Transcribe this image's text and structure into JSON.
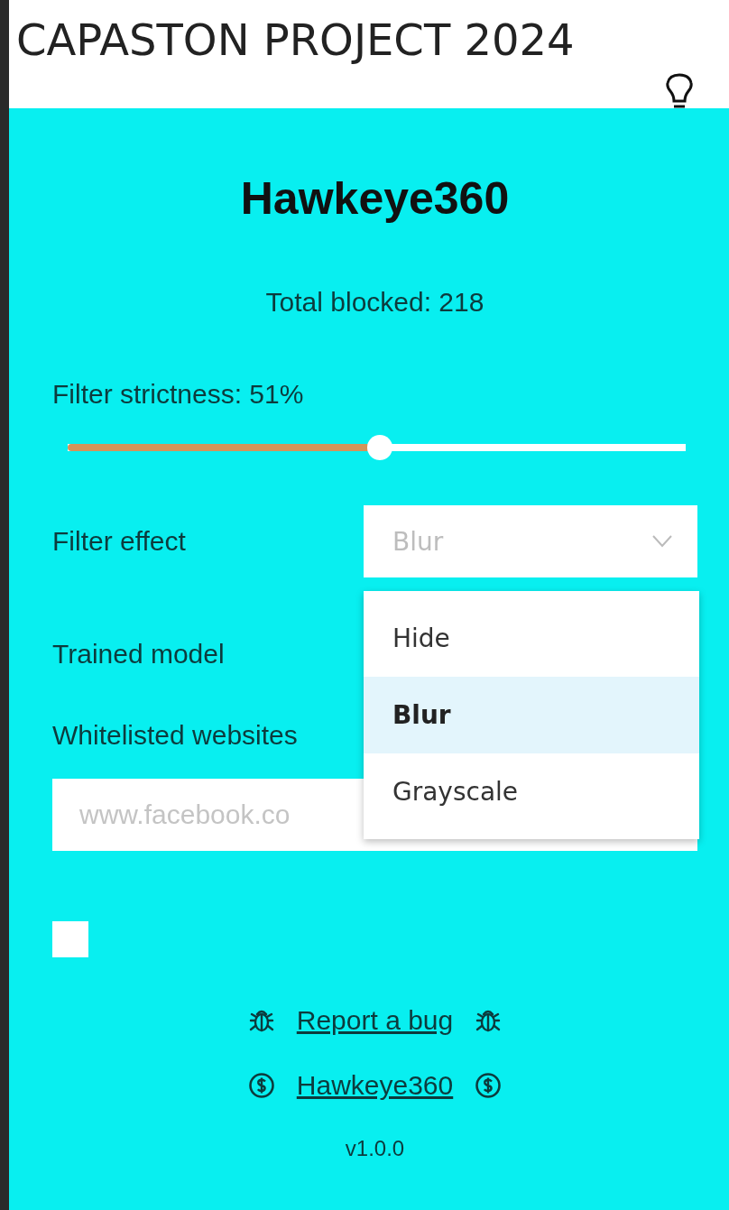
{
  "header": {
    "title": "CAPASTON PROJECT 2024"
  },
  "app": {
    "title": "Hawkeye360",
    "total_blocked": "Total blocked: 218"
  },
  "strictness": {
    "label": "Filter strictness: 51%",
    "level": 0.505
  },
  "filter_effect": {
    "label": "Filter effect",
    "value": "Blur",
    "options": [
      {
        "label": "Hide",
        "selected": false
      },
      {
        "label": "Blur",
        "selected": true
      },
      {
        "label": "Grayscale",
        "selected": false
      }
    ]
  },
  "trained_model": {
    "label": "Trained model"
  },
  "whitelist": {
    "label": "Whitelisted websites",
    "placeholder": "www.facebook.co"
  },
  "checkbox": {
    "checked": false
  },
  "links": [
    {
      "kind": "bug",
      "label": "Report a bug"
    },
    {
      "kind": "dollar",
      "label": "Hawkeye360"
    }
  ],
  "version": "v1.0.0"
}
